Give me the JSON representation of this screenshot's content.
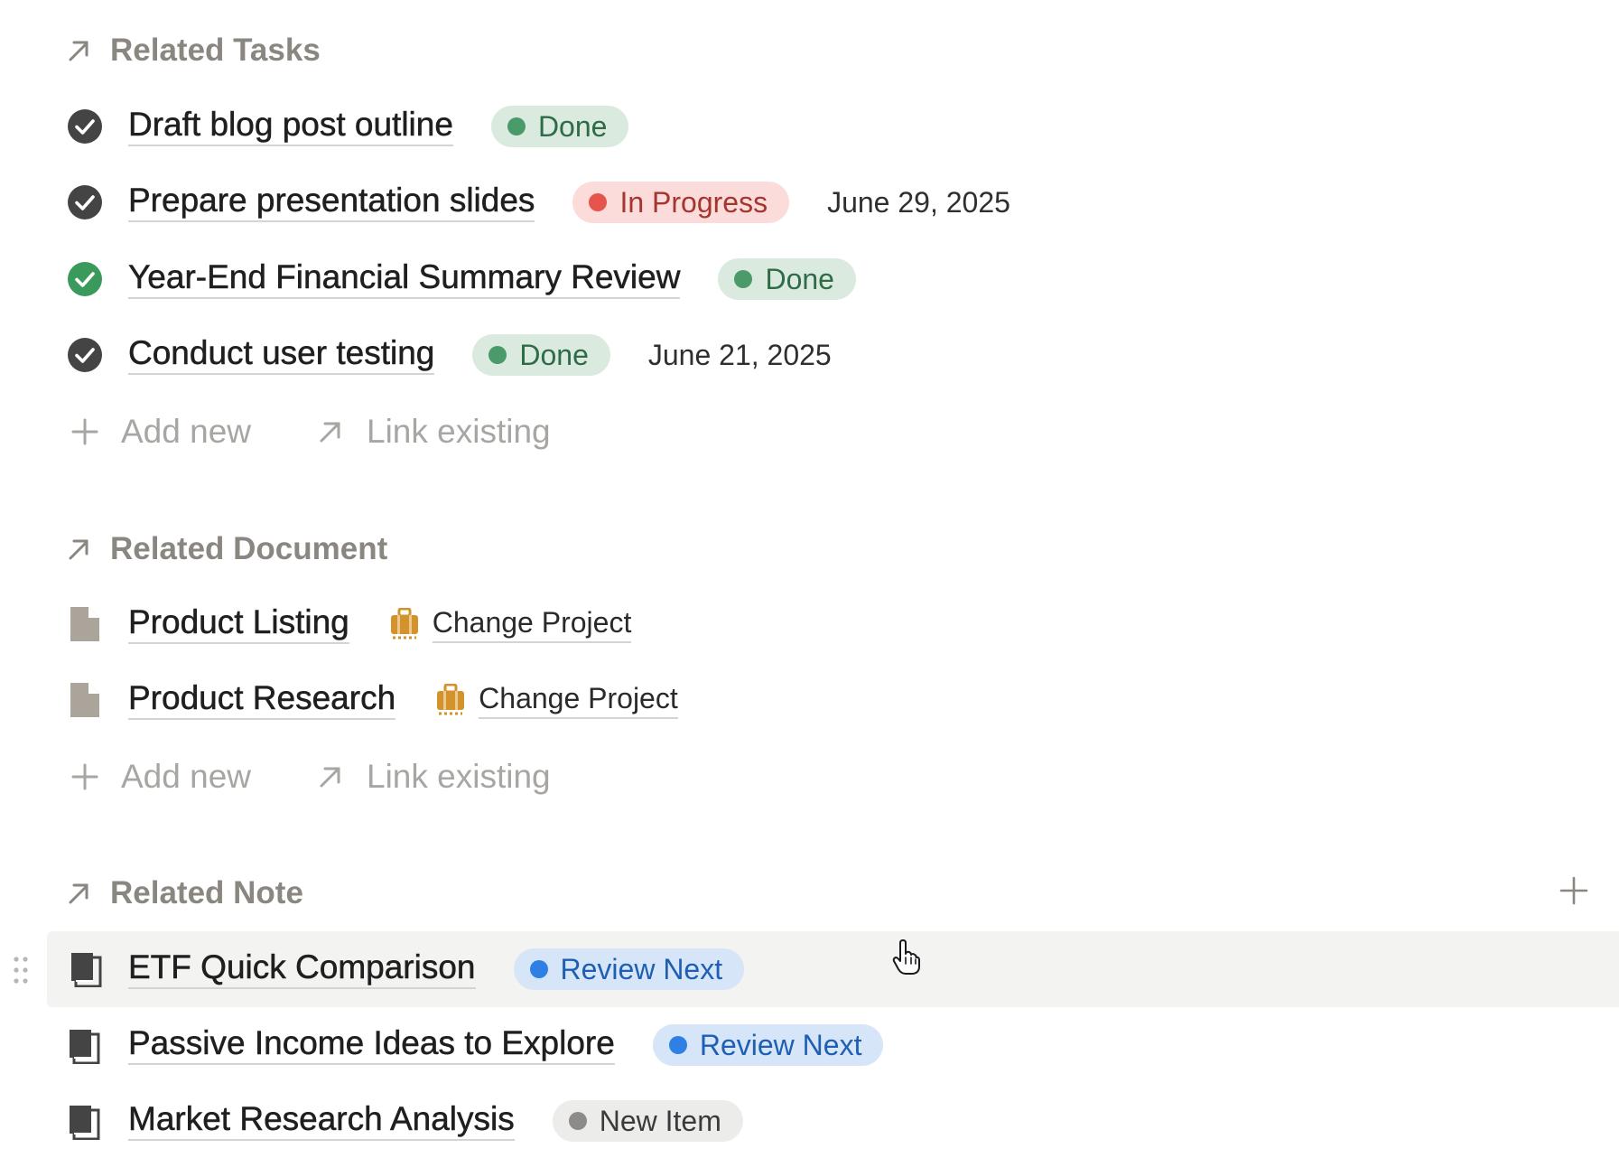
{
  "sections": {
    "tasks": {
      "title": "Related Tasks",
      "items": [
        {
          "title": "Draft blog post outline",
          "status": "Done",
          "date": ""
        },
        {
          "title": "Prepare presentation slides",
          "status": "In Progress",
          "date": "June 29, 2025"
        },
        {
          "title": "Year-End Financial Summary Review",
          "status": "Done",
          "date": ""
        },
        {
          "title": "Conduct user testing",
          "status": "Done",
          "date": "June 21, 2025"
        }
      ],
      "add_new": "Add new",
      "link_existing": "Link existing"
    },
    "documents": {
      "title": "Related Document",
      "items": [
        {
          "title": "Product Listing",
          "project": "Change Project"
        },
        {
          "title": "Product Research",
          "project": "Change Project"
        }
      ],
      "add_new": "Add new",
      "link_existing": "Link existing"
    },
    "notes": {
      "title": "Related Note",
      "items": [
        {
          "title": "ETF Quick Comparison",
          "status": "Review Next"
        },
        {
          "title": "Passive Income Ideas to Explore",
          "status": "Review Next"
        },
        {
          "title": "Market Research Analysis",
          "status": "New Item"
        }
      ]
    }
  },
  "colors": {
    "done": "#4a9a6a",
    "in_progress": "#e5544d",
    "review_next": "#2f80e4",
    "new_item": "#8c8b88",
    "task_check_default": "#444444",
    "task_check_highlight": "#3a9a5c",
    "project_icon": "#d4922a"
  },
  "icons": {
    "section_relation": "arrow-up-right-icon",
    "task": "check-circle-icon",
    "document": "page-icon",
    "note": "notebook-icon",
    "project": "briefcase-icon",
    "add": "plus-icon",
    "link": "arrow-up-right-icon"
  }
}
